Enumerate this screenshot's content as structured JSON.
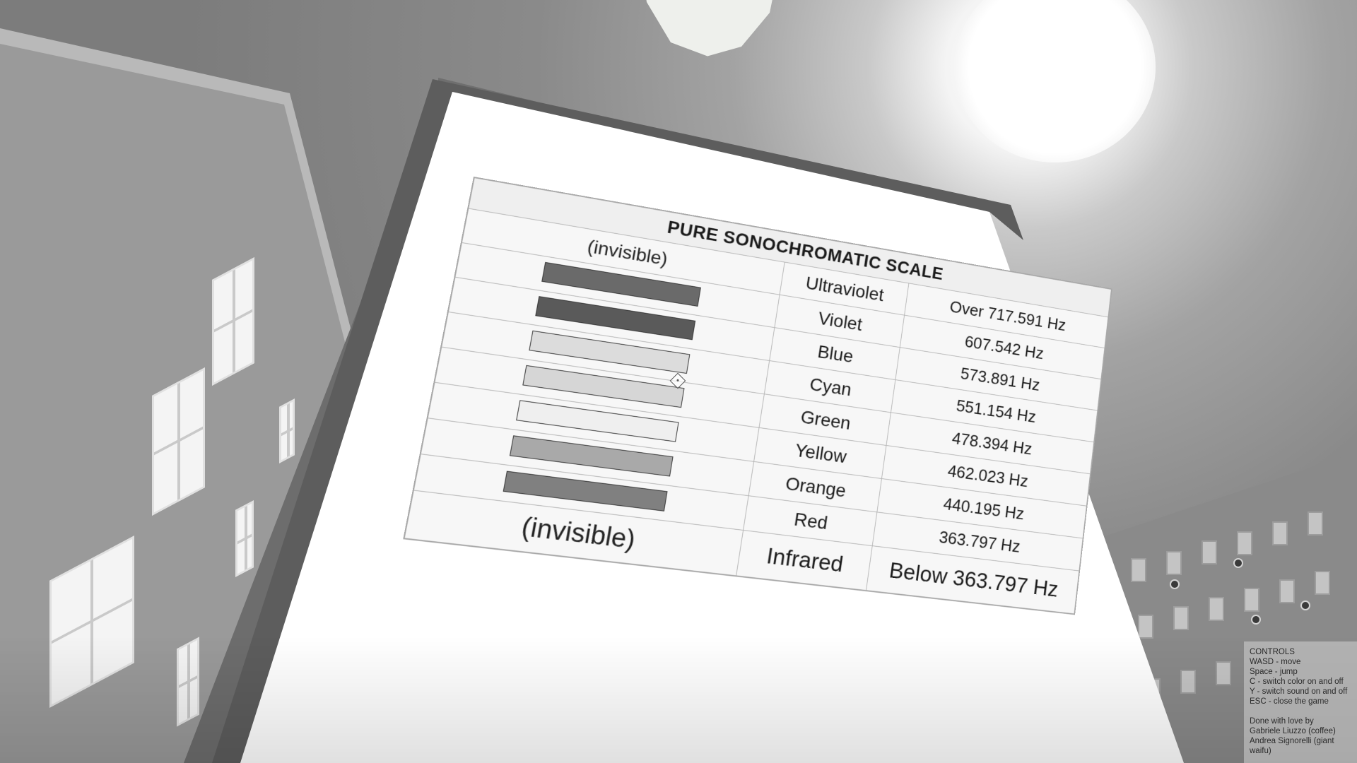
{
  "chart": {
    "title": "PURE SONOCHROMATIC SCALE",
    "rows": [
      {
        "swatch_label": "(invisible)",
        "swatch_color": null,
        "name": "Ultraviolet",
        "frequency": "Over 717.591 Hz"
      },
      {
        "swatch_label": "",
        "swatch_color": "#6a6a6a",
        "name": "Violet",
        "frequency": "607.542 Hz"
      },
      {
        "swatch_label": "",
        "swatch_color": "#5a5a5a",
        "name": "Blue",
        "frequency": "573.891 Hz"
      },
      {
        "swatch_label": "",
        "swatch_color": "#dcdcdc",
        "name": "Cyan",
        "frequency": "551.154 Hz"
      },
      {
        "swatch_label": "",
        "swatch_color": "#d6d6d6",
        "name": "Green",
        "frequency": "478.394 Hz"
      },
      {
        "swatch_label": "",
        "swatch_color": "#efefef",
        "name": "Yellow",
        "frequency": "462.023 Hz"
      },
      {
        "swatch_label": "",
        "swatch_color": "#a9a9a9",
        "name": "Orange",
        "frequency": "440.195 Hz"
      },
      {
        "swatch_label": "",
        "swatch_color": "#808080",
        "name": "Red",
        "frequency": "363.797 Hz"
      },
      {
        "swatch_label": "(invisible)",
        "swatch_color": null,
        "name": "Infrared",
        "frequency": "Below 363.797 Hz"
      }
    ]
  },
  "hud": {
    "heading": "CONTROLS",
    "lines": [
      "WASD - move",
      "Space - jump",
      "C - switch color on and off",
      "Y - switch sound on and off",
      "ESC - close the game"
    ],
    "credits_heading": "Done with love by",
    "credits": [
      "Gabriele Liuzzo (coffee)",
      "Andrea Signorelli (giant",
      "waifu)"
    ]
  }
}
